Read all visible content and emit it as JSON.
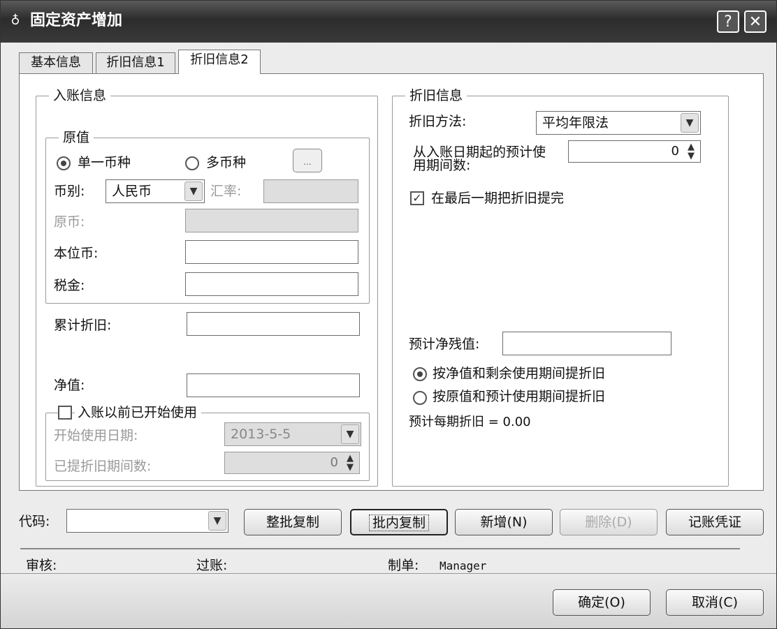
{
  "window": {
    "title": "固定资产增加",
    "help_label": "?",
    "close_label": "✕"
  },
  "tabs": [
    {
      "label": "基本信息"
    },
    {
      "label": "折旧信息1"
    },
    {
      "label": "折旧信息2",
      "active": true
    }
  ],
  "entry": {
    "legend": "入账信息",
    "original": {
      "legend": "原值",
      "single_currency_label": "单一币种",
      "multi_currency_label": "多币种",
      "ellipsis_label": "...",
      "currency_label": "币别:",
      "currency_value": "人民币",
      "rate_label": "汇率:",
      "orig_currency_label": "原币:",
      "base_currency_label": "本位币:",
      "tax_label": "税金:"
    },
    "accum_dep_label": "累计折旧:",
    "net_value_label": "净值:",
    "used_before": {
      "label": "入账以前已开始使用",
      "start_date_label": "开始使用日期:",
      "start_date_value": "2013-5-5",
      "periods_label": "已提折旧期间数:",
      "periods_value": "0"
    }
  },
  "depreciation": {
    "legend": "折旧信息",
    "method_label": "折旧方法:",
    "method_value": "平均年限法",
    "periods_label_1": "从入账日期起的预计使",
    "periods_label_2": "用期间数:",
    "periods_value": "0",
    "final_period_label": "在最后一期把折旧提完",
    "residual_label": "预计净残值:",
    "option_net_label": "按净值和剩余使用期间提折旧",
    "option_orig_label": "按原值和预计使用期间提折旧",
    "per_period_label": "预计每期折旧 = 0.00"
  },
  "bottom": {
    "code_label": "代码:",
    "buttons": {
      "batch_copy": "整批复制",
      "inbatch_copy": "批内复制",
      "add": "新增(N)",
      "delete": "删除(D)",
      "voucher": "记账凭证"
    },
    "audit_label": "审核:",
    "post_label": "过账:",
    "maker_label": "制单:",
    "maker_value": "Manager"
  },
  "footer": {
    "ok_label": "确定(O)",
    "cancel_label": "取消(C)"
  }
}
